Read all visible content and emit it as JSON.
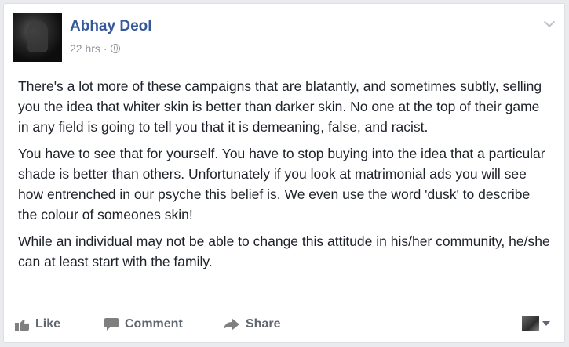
{
  "post": {
    "author": "Abhay Deol",
    "timestamp": "22 hrs",
    "separator": "·",
    "privacy_icon": "globe-icon",
    "paragraphs": [
      "There's a lot more of these campaigns that are blatantly, and sometimes subtly, selling you the idea that whiter skin is better than darker skin. No one at the top of their game in any field is going to tell you that it is demeaning, false, and racist.",
      "You have to see that for yourself. You have to stop buying into the idea that a particular shade is better than others. Unfortunately if you look at matrimonial ads you will see how entrenched in our psyche this belief is. We even use the word 'dusk' to describe the colour of someones skin!",
      "While an individual may not be able to change this attitude in his/her community, he/she can at least start with the family."
    ]
  },
  "actions": {
    "like": "Like",
    "comment": "Comment",
    "share": "Share"
  },
  "colors": {
    "author_link": "#365899",
    "text": "#1d2129",
    "meta": "#90949c",
    "action": "#616770"
  }
}
